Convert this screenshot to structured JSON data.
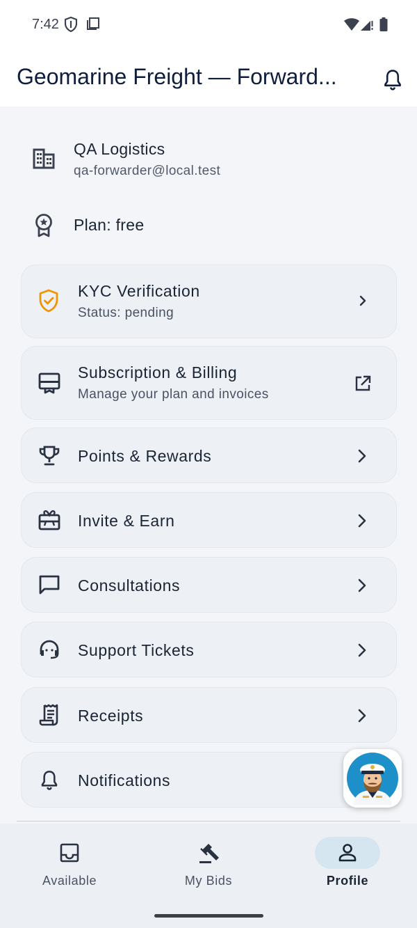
{
  "status_bar": {
    "time": "7:42",
    "left_icons": [
      "vpn-shield-icon",
      "clipboard-icon"
    ],
    "right_icons": [
      "wifi-icon",
      "signal-icon",
      "battery-icon"
    ]
  },
  "app_bar": {
    "title": "Geomarine Freight — Forward...",
    "action_icon": "bell-icon"
  },
  "profile": {
    "company": "QA Logistics",
    "email": "qa-forwarder@local.test",
    "company_icon": "building-icon",
    "plan_label": "Plan: free",
    "plan_icon": "award-badge-icon"
  },
  "menu": {
    "kyc": {
      "title": "KYC Verification",
      "subtitle": "Status: pending",
      "icon": "shield-check-icon",
      "icon_color": "#f29400",
      "trailing": "chevron-right-icon"
    },
    "subscription": {
      "title": "Subscription & Billing",
      "subtitle": "Manage your plan and invoices",
      "icon": "card-membership-icon",
      "trailing": "open-in-new-icon"
    },
    "points": {
      "title": "Points & Rewards",
      "icon": "trophy-icon",
      "trailing": "chevron-right-icon"
    },
    "invite": {
      "title": "Invite & Earn",
      "icon": "gift-card-icon",
      "trailing": "chevron-right-icon"
    },
    "consultations": {
      "title": "Consultations",
      "icon": "chat-bubble-icon",
      "trailing": "chevron-right-icon"
    },
    "support": {
      "title": "Support Tickets",
      "icon": "support-agent-icon",
      "trailing": "chevron-right-icon"
    },
    "receipts": {
      "title": "Receipts",
      "icon": "receipt-icon",
      "trailing": "chevron-right-icon"
    },
    "notifications": {
      "title": "Notifications",
      "icon": "bell-icon"
    }
  },
  "assistant_fab": {
    "icon": "captain-avatar-icon"
  },
  "bottom_nav": {
    "items": [
      {
        "label": "Available",
        "icon": "inbox-icon",
        "active": false
      },
      {
        "label": "My Bids",
        "icon": "gavel-icon",
        "active": false
      },
      {
        "label": "Profile",
        "icon": "person-icon",
        "active": true
      }
    ]
  },
  "colors": {
    "accent": "#0f1e3d",
    "warning": "#f29400",
    "nav_active_pill": "#d5e6f1",
    "card_bg": "#edf1f6"
  }
}
